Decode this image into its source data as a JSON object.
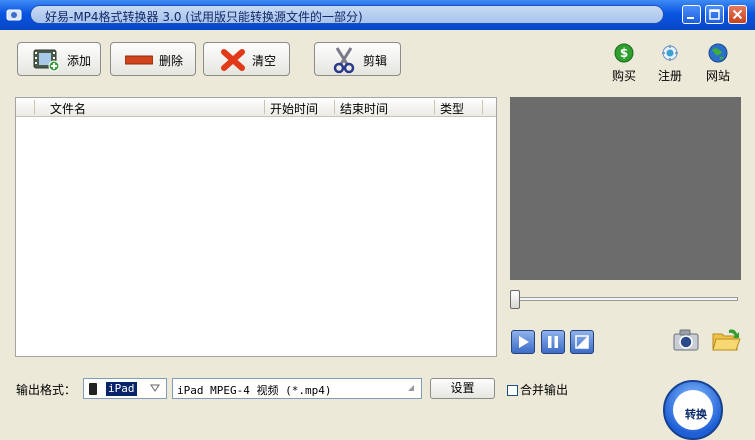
{
  "window": {
    "title": "好易-MP4格式转换器 3.0 (试用版只能转换源文件的一部分)"
  },
  "toolbar": {
    "add_label": "添加",
    "delete_label": "删除",
    "clear_label": "清空",
    "clip_label": "剪辑"
  },
  "links": {
    "buy_label": "购买",
    "register_label": "注册",
    "website_label": "网站"
  },
  "file_list": {
    "columns": [
      "文件名",
      "开始时间",
      "结束时间",
      "类型"
    ]
  },
  "output": {
    "label": "输出格式：",
    "device_value": "iPad",
    "format_value": "iPad MPEG-4 视频 (*.mp4)",
    "settings_label": "设置",
    "merge_label": "合并输出"
  },
  "convert": {
    "label": "转换"
  },
  "icons": {
    "app": "app-film-icon",
    "add": "film-add-icon",
    "delete": "minus-bar-icon",
    "clear": "red-x-icon",
    "clip": "scissors-icon",
    "buy": "dollar-coin-icon",
    "register": "register-icon",
    "website": "globe-icon",
    "play": "play-icon",
    "pause": "pause-icon",
    "fullscreen": "fullscreen-icon",
    "snapshot": "camera-icon",
    "open_folder": "folder-open-icon"
  },
  "colors": {
    "titlebar": "#0a55e0",
    "preview_bg": "#6c6c6c",
    "selected_bg": "#0a246a"
  }
}
